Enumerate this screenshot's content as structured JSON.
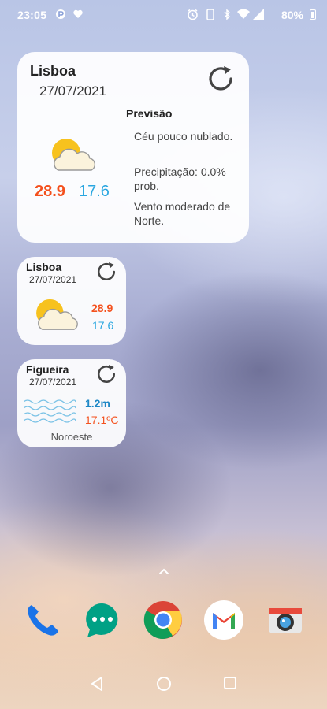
{
  "status_bar": {
    "time": "23:05",
    "battery": "80%"
  },
  "widgets": {
    "large": {
      "city": "Lisboa",
      "date": "27/07/2021",
      "forecast_title": "Previsão",
      "forecast_lines": [
        "Céu pouco nublado.",
        "Precipitação: 0.0% prob.",
        "Vento moderado de Norte."
      ],
      "temp_max": "28.9",
      "temp_min": "17.6"
    },
    "small": {
      "city": "Lisboa",
      "date": "27/07/2021",
      "temp_max": "28.9",
      "temp_min": "17.6"
    },
    "sea": {
      "city": "Figueira",
      "date": "27/07/2021",
      "wave_height": "1.2m",
      "water_temp": "17.1ºC",
      "wind": "Noroeste"
    }
  },
  "dock": {
    "apps": [
      "phone-icon",
      "messages-icon",
      "chrome-icon",
      "gmail-icon",
      "camera-icon"
    ]
  },
  "colors": {
    "temp_max": "#f4511e",
    "temp_min": "#29a6e0",
    "wave": "#1e88c6"
  }
}
